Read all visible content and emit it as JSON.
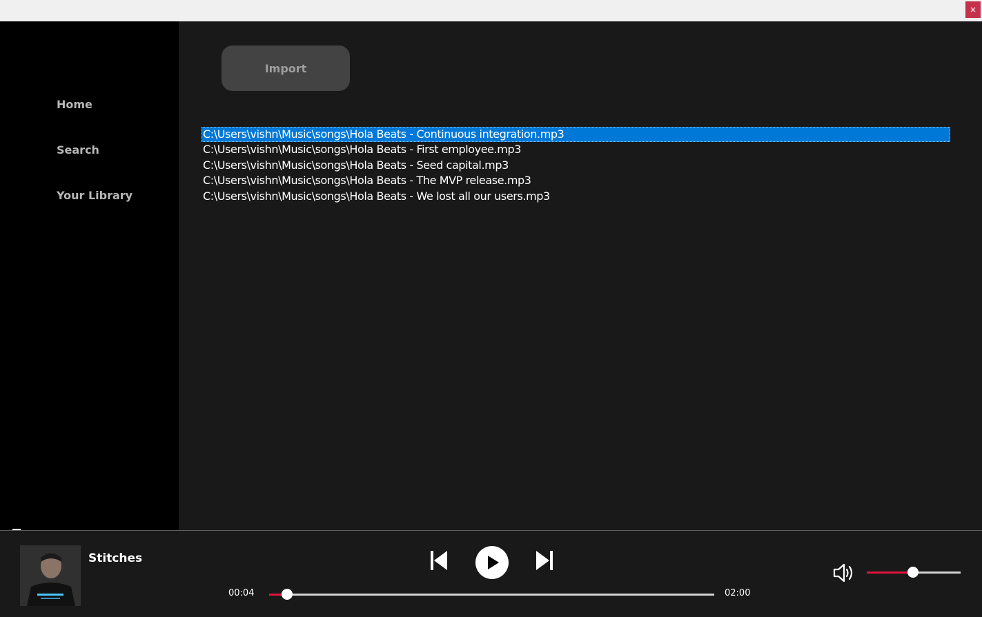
{
  "window": {
    "close_glyph": "×"
  },
  "sidebar": {
    "items": [
      {
        "label": "Home"
      },
      {
        "label": "Search"
      },
      {
        "label": "Your Library"
      }
    ]
  },
  "main": {
    "import_label": "Import",
    "files": [
      "C:\\Users\\vishn\\Music\\songs\\Hola Beats - Continuous integration.mp3",
      "C:\\Users\\vishn\\Music\\songs\\Hola Beats - First employee.mp3",
      "C:\\Users\\vishn\\Music\\songs\\Hola Beats - Seed capital.mp3",
      "C:\\Users\\vishn\\Music\\songs\\Hola Beats - The MVP release.mp3",
      "C:\\Users\\vishn\\Music\\songs\\Hola Beats - We lost all our users.mp3"
    ],
    "selected_index": 0
  },
  "player": {
    "track_title": "Stitches",
    "elapsed": "00:04",
    "duration": "02:00",
    "progress": 0.04,
    "volume": 0.49,
    "icons": [
      "previous-icon",
      "play-icon",
      "next-icon",
      "volume-icon"
    ],
    "accent_color": "#e0143c"
  }
}
